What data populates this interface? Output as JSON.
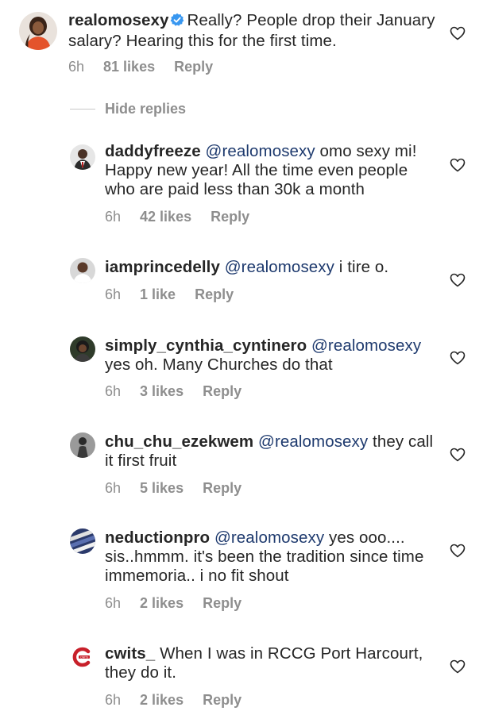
{
  "main_comment": {
    "username": "realomosexy",
    "text": "Really? People drop their January salary? Hearing this for the first time.",
    "time": "6h",
    "likes": "81 likes",
    "reply": "Reply"
  },
  "hide_replies": "Hide replies",
  "replies": [
    {
      "username": "daddyfreeze",
      "mention": "@realomosexy",
      "text": " omo sexy mi! Happy new year! All the time even people who are paid less than 30k a month",
      "time": "6h",
      "likes": "42 likes",
      "reply": "Reply"
    },
    {
      "username": "iamprincedelly",
      "mention": "@realomosexy",
      "text": " i tire o.",
      "time": "6h",
      "likes": "1 like",
      "reply": "Reply"
    },
    {
      "username": "simply_cynthia_cyntinero",
      "mention": "@realomosexy",
      "text": " yes oh. Many Churches do that",
      "time": "6h",
      "likes": "3 likes",
      "reply": "Reply"
    },
    {
      "username": "chu_chu_ezekwem",
      "mention": "@realomosexy",
      "text": " they call it first fruit",
      "time": "6h",
      "likes": "5 likes",
      "reply": "Reply"
    },
    {
      "username": "neductionpro",
      "mention": "@realomosexy",
      "text": " yes ooo.... sis..hmmm. it's been the tradition since time immemoria.. i no fit shout",
      "time": "6h",
      "likes": "2 likes",
      "reply": "Reply"
    },
    {
      "username": "cwits_",
      "mention": "",
      "text": "When I was in RCCG Port Harcourt, they do it.",
      "time": "6h",
      "likes": "2 likes",
      "reply": "Reply"
    }
  ],
  "icons": {
    "like": "heart-outline-icon",
    "verified": "verified-badge-icon"
  },
  "colors": {
    "text": "#262626",
    "meta": "#8e8e8e",
    "mention": "#1e3a6e",
    "verified": "#3897f0"
  }
}
